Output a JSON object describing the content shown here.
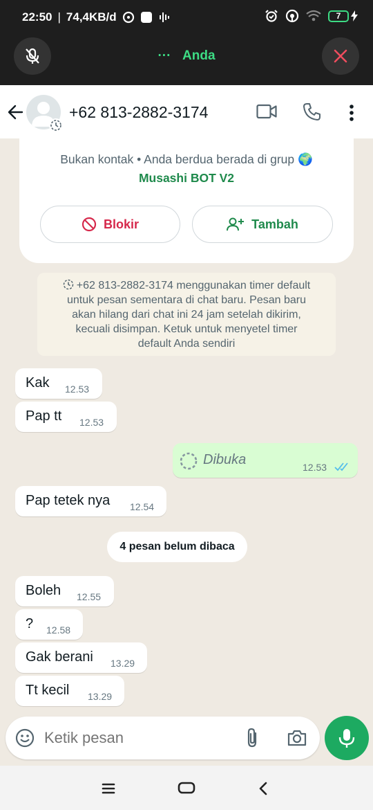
{
  "status_bar": {
    "time": "22:50",
    "speed": "74,4KB/d",
    "battery": "7"
  },
  "call_bar": {
    "dots": "···",
    "name": "Anda"
  },
  "header": {
    "phone": "+62 813-2882-3174"
  },
  "info_card": {
    "line": "Bukan kontak • Anda berdua berada di grup 🌍",
    "group": "Musashi BOT V2",
    "block_label": "Blokir",
    "add_label": "Tambah"
  },
  "system_note": {
    "lines": [
      "+62 813-2882-3174 menggunakan timer default",
      "untuk pesan sementara di chat baru. Pesan baru",
      "akan hilang dari chat ini 24 jam setelah dikirim,",
      "kecuali disimpan. Ketuk untuk menyetel timer",
      "default Anda sendiri"
    ]
  },
  "messages_before": [
    {
      "text": "Kak",
      "time": "12.53"
    },
    {
      "text": "Pap tt",
      "time": "12.53"
    }
  ],
  "outgoing": {
    "text": "Dibuka",
    "time": "12.53"
  },
  "message_mid": {
    "text": "Pap tetek nya",
    "time": "12.54"
  },
  "unread_label": "4 pesan belum dibaca",
  "messages_after": [
    {
      "text": "Boleh",
      "time": "12.55"
    },
    {
      "text": "?",
      "time": "12.58"
    },
    {
      "text": "Gak berani",
      "time": "13.29"
    },
    {
      "text": "Tt kecil",
      "time": "13.29"
    }
  ],
  "input": {
    "placeholder": "Ketik pesan"
  },
  "colors": {
    "accent_green": "#1daa61",
    "call_green": "#3ddc84",
    "block_red": "#d6284b",
    "outgoing_bubble": "#d9fdd3",
    "chat_bg": "#efeae2"
  }
}
